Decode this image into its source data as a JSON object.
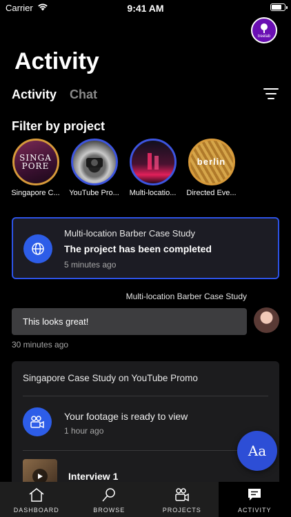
{
  "status": {
    "carrier": "Carrier",
    "time": "9:41 AM"
  },
  "header": {
    "title": "Activity",
    "avatar_text": "treelab"
  },
  "tabs": [
    {
      "label": "Activity",
      "active": true
    },
    {
      "label": "Chat",
      "active": false
    }
  ],
  "filter": {
    "title": "Filter by project",
    "projects": [
      {
        "label": "Singapore C...",
        "thumb_text": "SINGA\nPORE",
        "border": "#d79a3a"
      },
      {
        "label": "YouTube Pro...",
        "thumb_text": "",
        "border": "#3d55e0"
      },
      {
        "label": "Multi-locatio...",
        "thumb_text": "",
        "border": "#3d55e0"
      },
      {
        "label": "Directed Eve...",
        "thumb_text": "berlin",
        "border": "#d79a3a"
      }
    ]
  },
  "notification": {
    "project": "Multi-location Barber Case Study",
    "message": "The project has been completed",
    "time": "5 minutes ago"
  },
  "chat": {
    "project": "Multi-location Barber Case Study",
    "message": "This looks great!",
    "time": "30 minutes ago"
  },
  "group": {
    "title": "Singapore Case Study on YouTube Promo",
    "message": "Your footage is ready to view",
    "time": "1 hour ago",
    "video_label": "Interview 1"
  },
  "fab": {
    "label": "Aa"
  },
  "tabbar": [
    {
      "label": "DASHBOARD",
      "icon": "house-icon",
      "active": false
    },
    {
      "label": "BROWSE",
      "icon": "search-icon",
      "active": false
    },
    {
      "label": "PROJECTS",
      "icon": "video-people-icon",
      "active": false
    },
    {
      "label": "ACTIVITY",
      "icon": "chat-icon",
      "active": true
    }
  ],
  "colors": {
    "accent": "#2d5de8",
    "card": "#1c1c1e",
    "bubble": "#3d3d3f"
  }
}
